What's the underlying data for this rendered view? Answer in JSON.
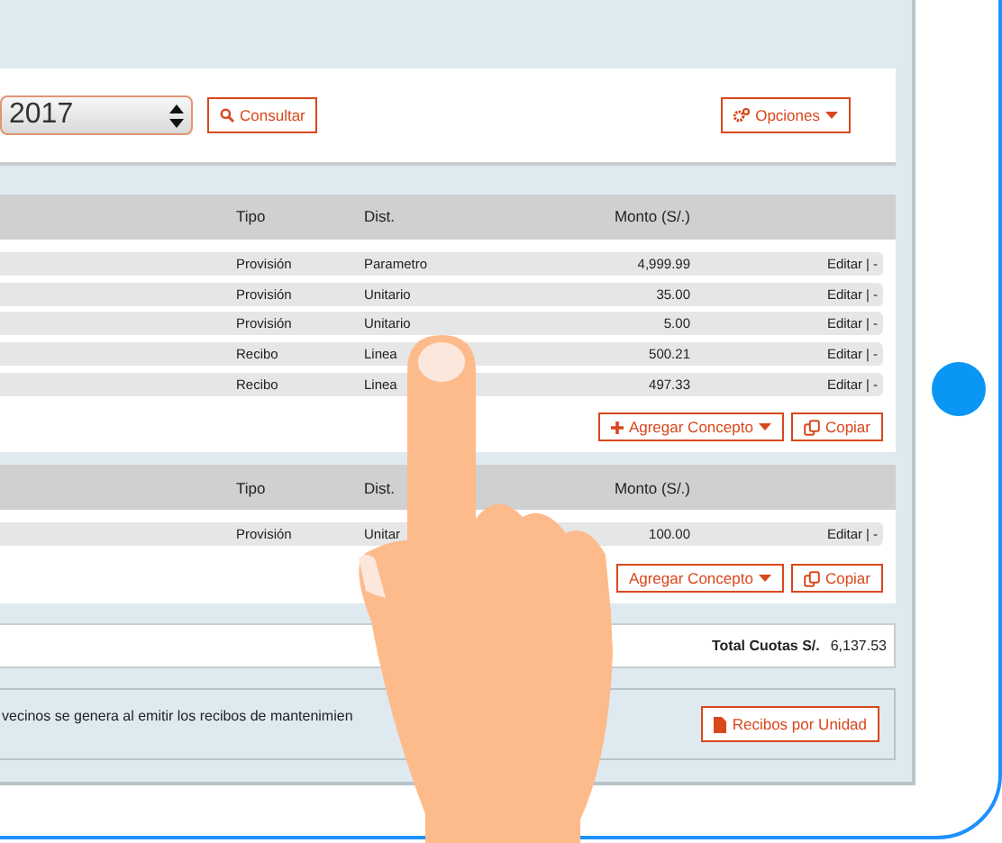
{
  "year_select": {
    "value": "2017"
  },
  "consult_button": {
    "label": "Consultar"
  },
  "options_button": {
    "label": "Opciones"
  },
  "tables": [
    {
      "columns": [
        "Tipo",
        "Dist.",
        "Monto (S/.)"
      ],
      "rows": [
        {
          "tipo": "Provisión",
          "dist": "Parametro",
          "monto": "4,999.99",
          "edit": "Editar",
          "separator": "|",
          "remove": "-"
        },
        {
          "tipo": "Provisión",
          "dist": "Unitario",
          "monto": "35.00",
          "edit": "Editar",
          "separator": "|",
          "remove": "-"
        },
        {
          "tipo": "Provisión",
          "dist": "Unitario",
          "monto": "5.00",
          "edit": "Editar",
          "separator": "|",
          "remove": "-"
        },
        {
          "tipo": "Recibo",
          "dist": "Linea",
          "monto": "500.21",
          "edit": "Editar",
          "separator": "|",
          "remove": "-"
        },
        {
          "tipo": "Recibo",
          "dist": "Linea",
          "monto": "497.33",
          "edit": "Editar",
          "separator": "|",
          "remove": "-"
        }
      ],
      "buttons": [
        {
          "label": "Agregar Concepto",
          "kind": "add"
        },
        {
          "label": "Copiar",
          "kind": "copy"
        }
      ]
    },
    {
      "columns": [
        "Tipo",
        "Dist.",
        "Monto (S/.)"
      ],
      "rows": [
        {
          "tipo": "Provisión",
          "dist": "Unitar",
          "monto": "100.00",
          "edit": "Editar",
          "separator": "|",
          "remove": "-"
        }
      ],
      "buttons": [
        {
          "label": "Agregar Concepto",
          "kind": "add",
          "icon_hidden": true
        },
        {
          "label": "Copiar",
          "kind": "copy"
        }
      ]
    }
  ],
  "total": {
    "label": "Total Cuotas S/.",
    "value": "6,137.53"
  },
  "note": "vecinos se genera al emitir los recibos de mantenimien",
  "receipts_button": {
    "label": "Recibos por Unidad"
  }
}
